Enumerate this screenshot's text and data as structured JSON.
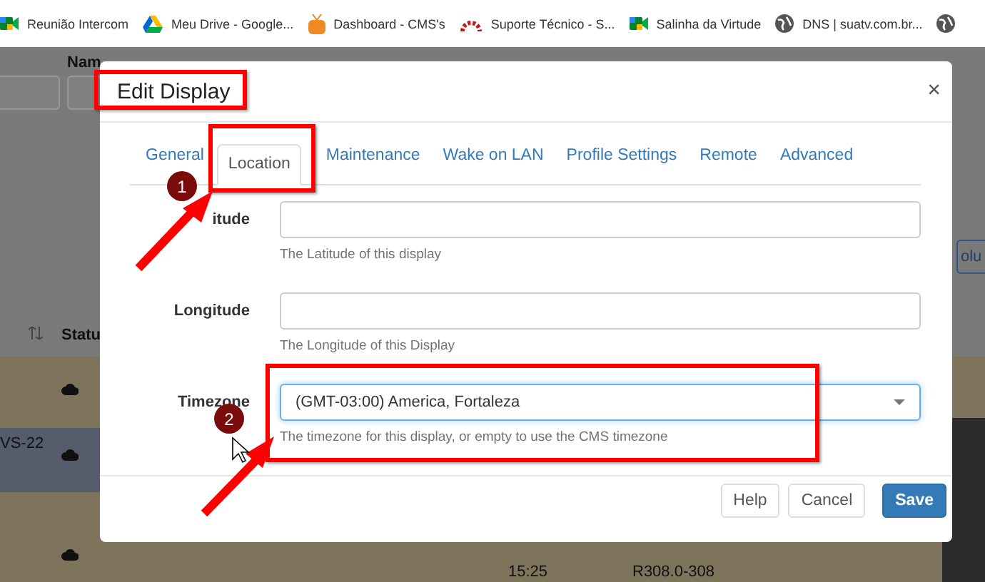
{
  "bookmarks": [
    {
      "label": "Reunião Intercom"
    },
    {
      "label": "Meu Drive - Google..."
    },
    {
      "label": "Dashboard - CMS's"
    },
    {
      "label": "Suporte Técnico - S..."
    },
    {
      "label": "Salinha da Virtude"
    },
    {
      "label": "DNS | suatv.com.br..."
    }
  ],
  "background": {
    "name_header": "Nam",
    "status_header": "Statu",
    "row_label": "VS-22",
    "button_text": "olu",
    "time": "15:25",
    "version": "R308.0-308"
  },
  "dialog": {
    "title": "Edit Display",
    "close": "×",
    "tabs": [
      {
        "label": "General",
        "selected": false
      },
      {
        "label": "Location",
        "selected": true
      },
      {
        "label": "Maintenance",
        "selected": false
      },
      {
        "label": "Wake on LAN",
        "selected": false
      },
      {
        "label": "Profile Settings",
        "selected": false
      },
      {
        "label": "Remote",
        "selected": false
      },
      {
        "label": "Advanced",
        "selected": false
      }
    ],
    "fields": [
      {
        "kind": "text",
        "label": "itude",
        "help": "The Latitude of this display"
      },
      {
        "kind": "text",
        "label": "Longitude",
        "help": "The Longitude of this Display"
      },
      {
        "kind": "select",
        "label": "Timezone",
        "value": "(GMT-03:00) America, Fortaleza",
        "help": "The timezone for this display, or empty to use the CMS timezone"
      }
    ],
    "buttons": [
      {
        "label": "Help",
        "kind": "default"
      },
      {
        "label": "Cancel",
        "kind": "default"
      },
      {
        "label": "Save",
        "kind": "primary"
      }
    ]
  },
  "annotations": {
    "markers": [
      "1",
      "2"
    ]
  }
}
